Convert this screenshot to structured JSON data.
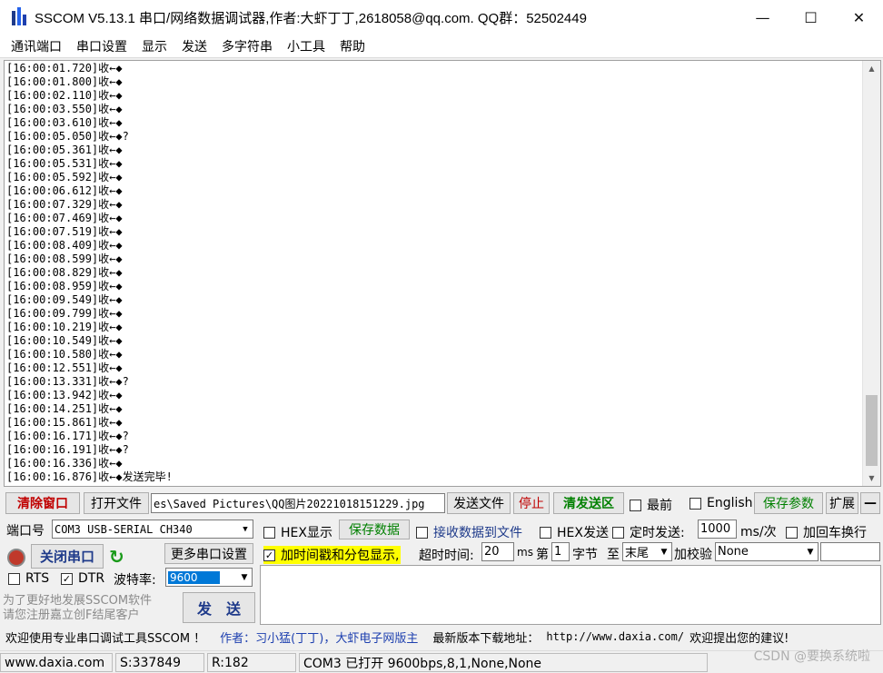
{
  "window": {
    "title": "SSCOM V5.13.1 串口/网络数据调试器,作者:大虾丁丁,2618058@qq.com. QQ群：52502449",
    "minimize": "—",
    "maximize": "☐",
    "close": "✕"
  },
  "menu": [
    "通讯端口",
    "串口设置",
    "显示",
    "发送",
    "多字符串",
    "小工具",
    "帮助"
  ],
  "log_lines": [
    "[16:00:01.720]收←◆",
    "[16:00:01.800]收←◆",
    "[16:00:02.110]收←◆",
    "[16:00:03.550]收←◆",
    "[16:00:03.610]收←◆",
    "[16:00:05.050]收←◆?",
    "[16:00:05.361]收←◆",
    "[16:00:05.531]收←◆",
    "[16:00:05.592]收←◆",
    "[16:00:06.612]收←◆",
    "[16:00:07.329]收←◆",
    "[16:00:07.469]收←◆",
    "[16:00:07.519]收←◆",
    "[16:00:08.409]收←◆",
    "[16:00:08.599]收←◆",
    "[16:00:08.829]收←◆",
    "[16:00:08.959]收←◆",
    "[16:00:09.549]收←◆",
    "[16:00:09.799]收←◆",
    "[16:00:10.219]收←◆",
    "[16:00:10.549]收←◆",
    "[16:00:10.580]收←◆",
    "[16:00:12.551]收←◆",
    "[16:00:13.331]收←◆?",
    "[16:00:13.942]收←◆",
    "[16:00:14.251]收←◆",
    "[16:00:15.861]收←◆",
    "[16:00:16.171]收←◆?",
    "[16:00:16.191]收←◆?",
    "[16:00:16.336]收←◆",
    "[16:00:16.876]收←◆发送完毕!"
  ],
  "toolbar": {
    "clear_window": "清除窗口",
    "open_file": "打开文件",
    "file_path": "es\\Saved Pictures\\QQ图片20221018151229.jpg",
    "send_file": "发送文件",
    "stop": "停止",
    "clear_send": "清发送区",
    "last_label": "最前",
    "english_label": "English",
    "save_params": "保存参数",
    "expand": "扩展",
    "collapse": "—"
  },
  "port": {
    "label": "端口号",
    "value": "COM3 USB-SERIAL CH340",
    "close_port": "关闭串口",
    "more_settings": "更多串口设置",
    "rts": "RTS",
    "dtr": "DTR",
    "baud_label": "波特率:",
    "baud_value": "9600"
  },
  "options": {
    "hex_display": "HEX显示",
    "save_data": "保存数据",
    "recv_to_file": "接收数据到文件",
    "hex_send": "HEX发送",
    "timed_send": "定时发送:",
    "interval": "1000",
    "interval_unit": "ms/次",
    "add_crlf": "加回车换行",
    "timestamp": "加时间戳和分包显示,",
    "timeout_label": "超时时间:",
    "timeout_value": "20",
    "timeout_unit": "ms",
    "byte_prefix": "第",
    "byte_index": "1",
    "byte_suffix": "字节",
    "to_label": "至",
    "to_value": "末尾",
    "checksum_label": "加校验",
    "checksum_value": "None"
  },
  "promo": {
    "line1": "为了更好地发展SSCOM软件",
    "line2": "请您注册嘉立创F结尾客户",
    "send_button": "发　送"
  },
  "marquee": {
    "welcome": "欢迎使用专业串口调试工具SSCOM ！",
    "author": "作者：习小猛(丁丁)，大虾电子网版主",
    "download_label": "最新版本下载地址：",
    "url": "http://www.daxia.com/",
    "feedback": "欢迎提出您的建议!"
  },
  "status": {
    "site": "www.daxia.com",
    "sent": "S:337849",
    "received": "R:182",
    "port_state": "COM3 已打开  9600bps,8,1,None,None"
  },
  "watermark": "CSDN @要换系统啦"
}
